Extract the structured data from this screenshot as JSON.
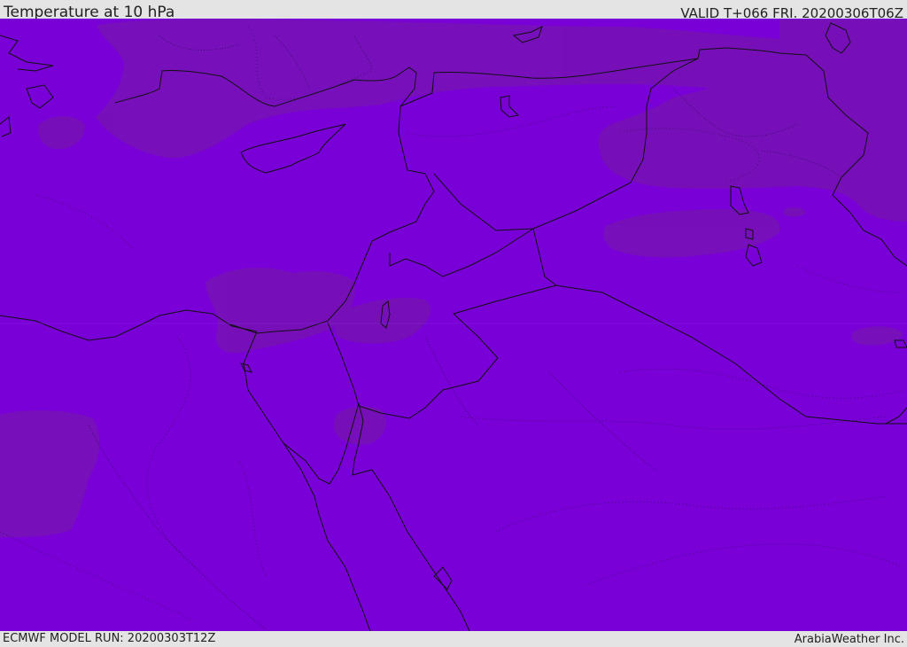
{
  "header": {
    "title": "Temperature at 10 hPa",
    "valid": "VALID T+066 FRI. 20200306T06Z"
  },
  "footer": {
    "model_run": "ECMWF MODEL RUN: 20200303T12Z",
    "brand": "ArabiaWeather Inc."
  },
  "map": {
    "base_color": "#7a00d8",
    "warm_patch_color": "#7710b8",
    "coastline_color": "#111111"
  }
}
